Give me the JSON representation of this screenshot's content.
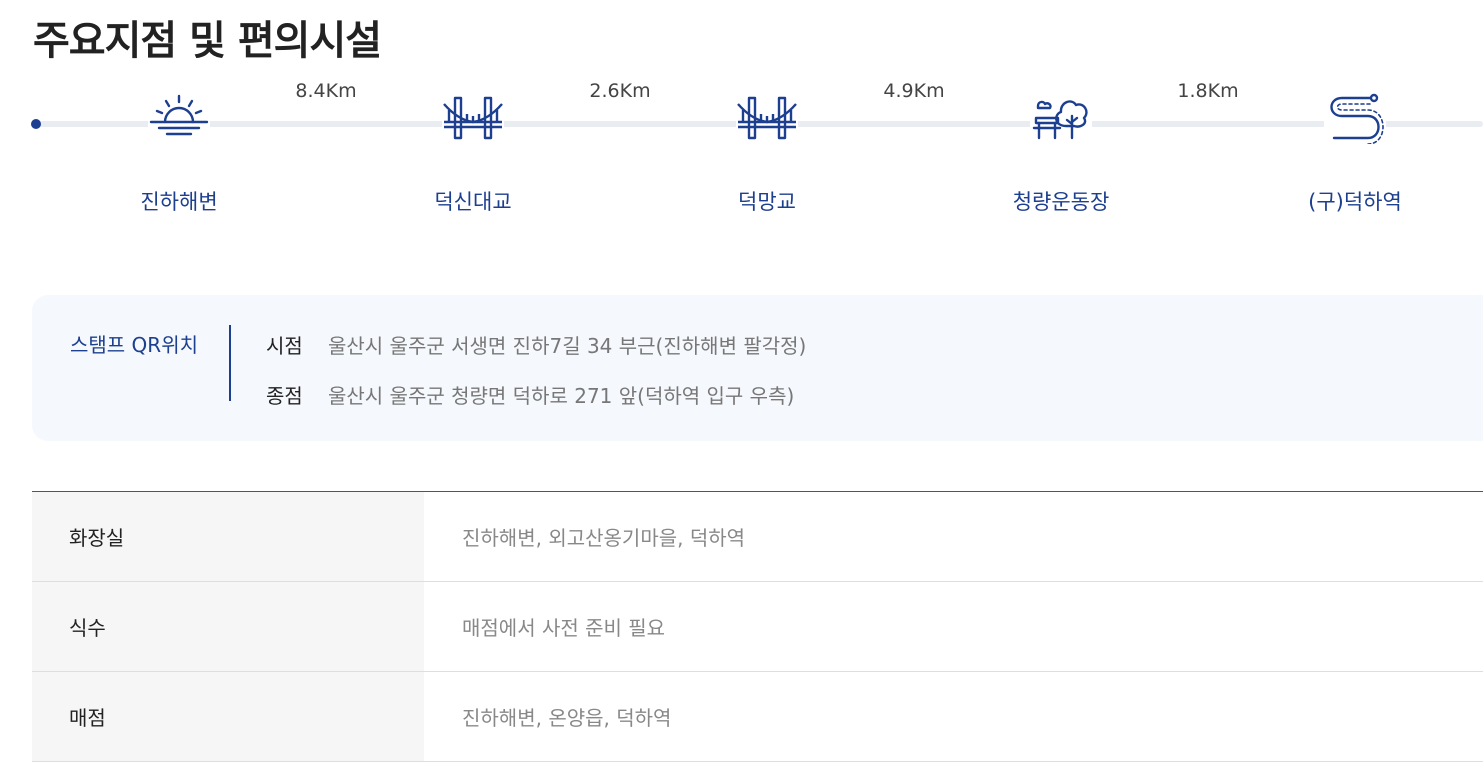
{
  "page": {
    "title": "주요지점 및 편의시설"
  },
  "route": {
    "stops": [
      {
        "label": "진하해변",
        "icon": "sunrise-icon"
      },
      {
        "label": "덕신대교",
        "icon": "bridge-icon"
      },
      {
        "label": "덕망교",
        "icon": "bridge-icon"
      },
      {
        "label": "청량운동장",
        "icon": "park-bench-tree-icon"
      },
      {
        "label": "(구)덕하역",
        "icon": "winding-road-icon"
      }
    ],
    "distances": [
      "8.4Km",
      "2.6Km",
      "4.9Km",
      "1.8Km"
    ]
  },
  "stamp": {
    "title": "스탬프 QR위치",
    "start_label": "시점",
    "start_value": "울산시 울주군 서생면 진하7길 34 부근(진하해변 팔각정)",
    "end_label": "종점",
    "end_value": "울산시 울주군 청량면 덕하로 271 앞(덕하역 입구 우측)"
  },
  "facilities": [
    {
      "name": "화장실",
      "value": "진하해변, 외고산옹기마을, 덕하역"
    },
    {
      "name": "식수",
      "value": "매점에서 사전 준비 필요"
    },
    {
      "name": "매점",
      "value": "진하해변, 온양읍, 덕하역"
    }
  ],
  "colors": {
    "accent": "#1d3f8f",
    "route_line": "#e9edf2",
    "stamp_bg": "#f5f8fc"
  }
}
